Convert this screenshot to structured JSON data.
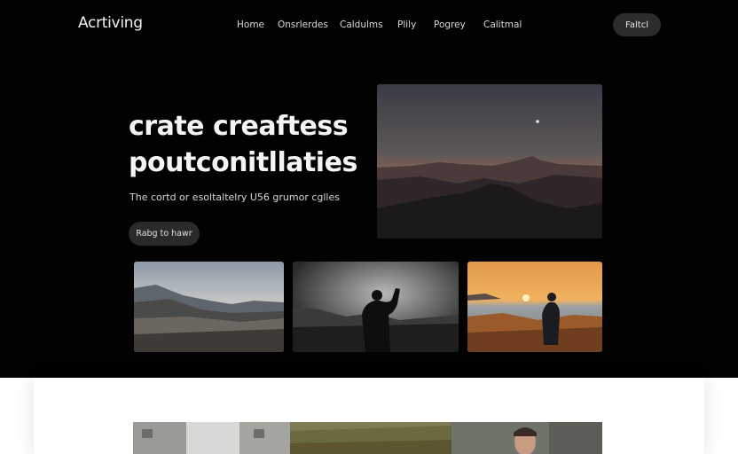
{
  "brand": {
    "name": "Acrtiving"
  },
  "nav": {
    "items": [
      {
        "label": "Home"
      },
      {
        "label": "Onsrlerdes"
      },
      {
        "label": "Caldulms"
      },
      {
        "label": "Plily"
      },
      {
        "label": "Pogrey"
      },
      {
        "label": "Calitmal"
      }
    ],
    "cta_label": "Faltcl"
  },
  "hero": {
    "headline_line1": "crate creaftess",
    "headline_line2": "poutconitllaties",
    "subtext": "The cortd or esoltaltelry U56 grumor cglles",
    "cta_label": "Rabg to hawr"
  },
  "images": {
    "main": "mountain-sunset-photo",
    "thumbs": [
      "mountain-valley-photo",
      "man-raising-arm-photo",
      "person-at-sunset-photo"
    ],
    "strip": [
      "building-street-photo",
      "grass-field-photo",
      "man-portrait-photo"
    ]
  },
  "colors": {
    "hero_bg": "#020202",
    "section_bg": "#ffffff",
    "button_bg": "#2a2a2a",
    "text_light": "#f4f4f4"
  }
}
